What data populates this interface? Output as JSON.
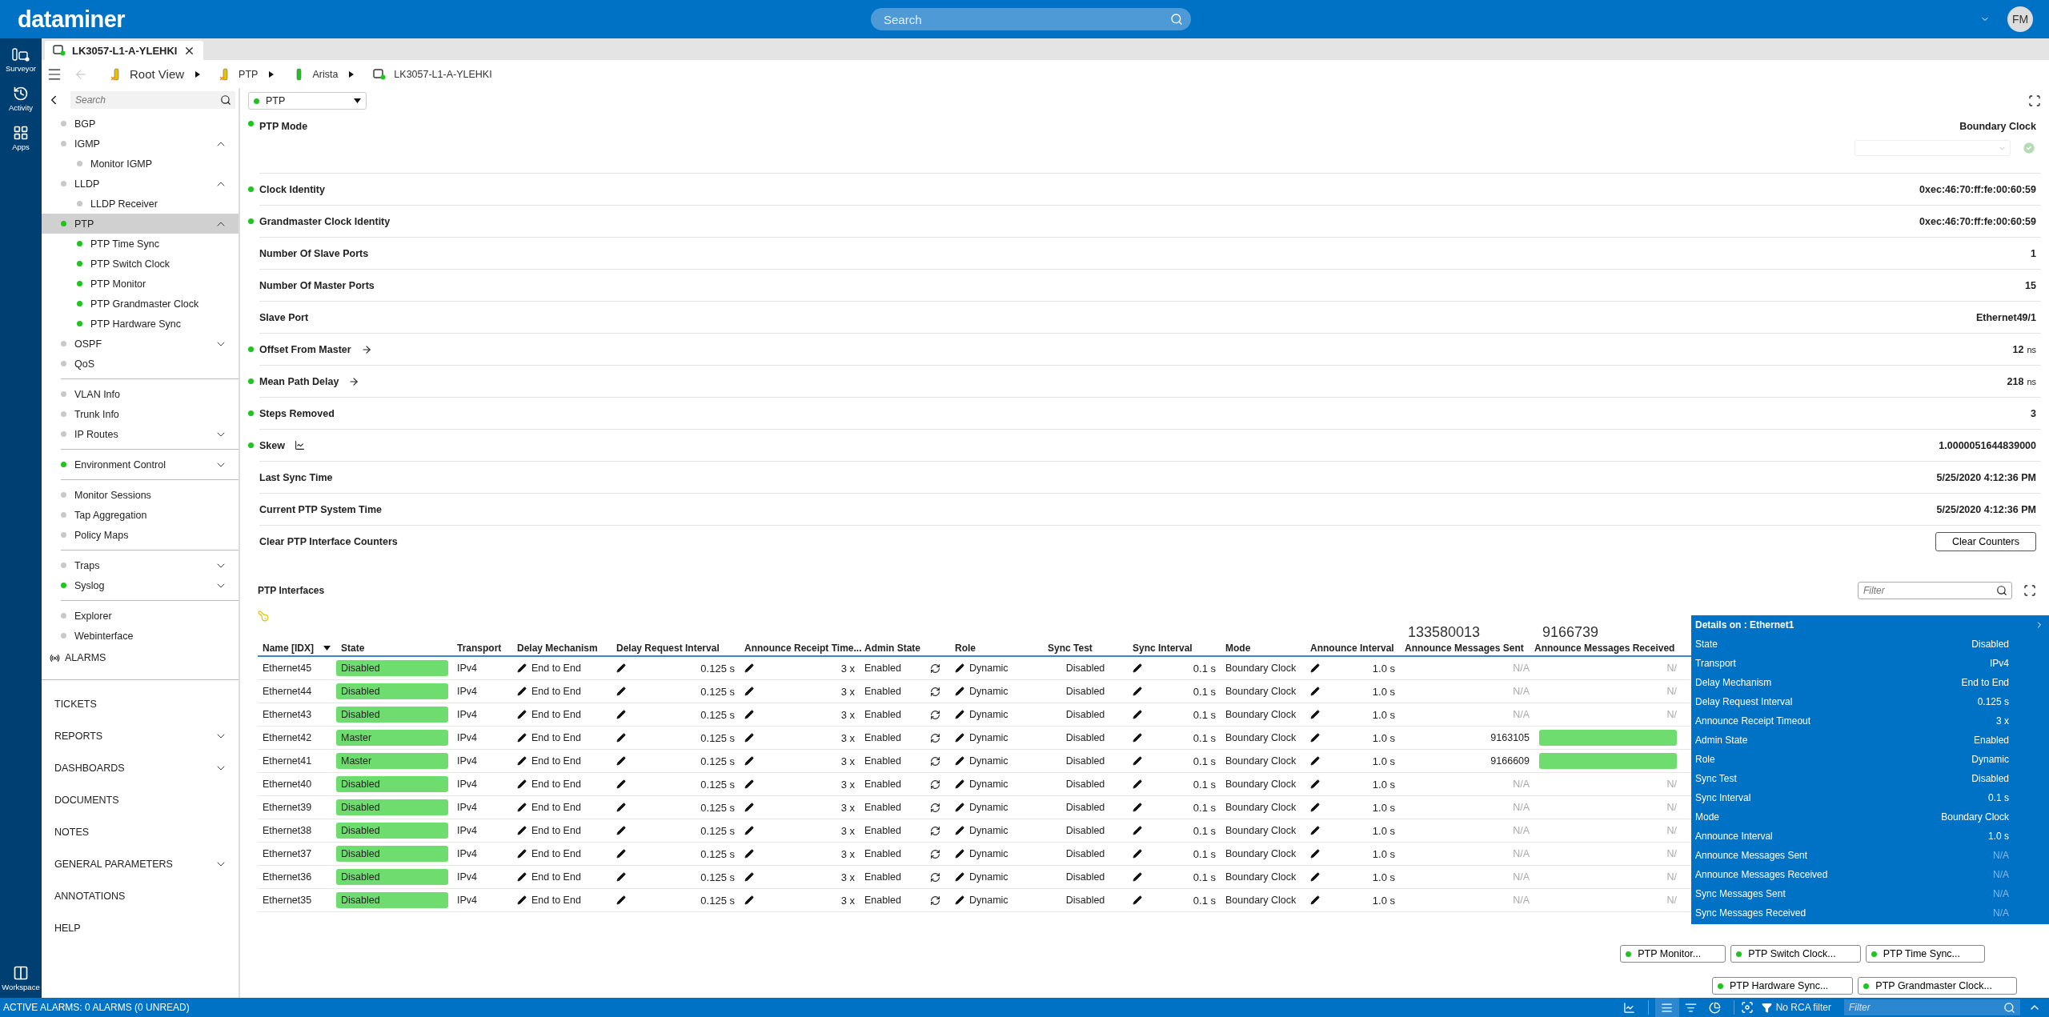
{
  "header": {
    "logo": "dataminer",
    "search_placeholder": "Search",
    "avatar": "FM"
  },
  "rail": {
    "items": [
      {
        "label": "Surveyor",
        "kind": "surveyor"
      },
      {
        "label": "Activity",
        "kind": "activity"
      },
      {
        "label": "Apps",
        "kind": "apps"
      }
    ],
    "bottom": "Workspace"
  },
  "tabs": [
    {
      "label": "LK3057-L1-A-YLEHKI",
      "selected": true
    }
  ],
  "breadcrumb": [
    {
      "label": "Root View",
      "kind": "view"
    },
    {
      "label": "PTP",
      "kind": "view"
    },
    {
      "label": "Arista",
      "kind": "protocol"
    },
    {
      "label": "LK3057-L1-A-YLEHKI",
      "kind": "element"
    }
  ],
  "sidebar": {
    "search_placeholder": "Search",
    "groups": [
      [
        {
          "label": "BGP",
          "color": "#c8c8c8",
          "selected": false
        },
        {
          "label": "IGMP",
          "color": "#c8c8c8",
          "selected": false,
          "expanded": true,
          "children": [
            {
              "label": "Monitor IGMP",
              "color": "#c8c8c8",
              "selected": false
            }
          ]
        },
        {
          "label": "LLDP",
          "color": "#c8c8c8",
          "selected": false,
          "expanded": true,
          "children": [
            {
              "label": "LLDP Receiver",
              "color": "#c8c8c8",
              "selected": false
            }
          ]
        },
        {
          "label": "PTP",
          "color": "#1fc41f",
          "selected": true,
          "expanded": true,
          "children": [
            {
              "label": "PTP Time Sync",
              "color": "#1fc41f",
              "selected": false
            },
            {
              "label": "PTP Switch Clock",
              "color": "#1fc41f",
              "selected": false
            },
            {
              "label": "PTP Monitor",
              "color": "#1fc41f",
              "selected": false
            },
            {
              "label": "PTP Grandmaster Clock",
              "color": "#1fc41f",
              "selected": false
            },
            {
              "label": "PTP Hardware Sync",
              "color": "#1fc41f",
              "selected": false
            }
          ]
        },
        {
          "label": "OSPF",
          "color": "#c8c8c8",
          "selected": false,
          "expanded": false
        },
        {
          "label": "QoS",
          "color": "#c8c8c8",
          "selected": false
        }
      ],
      [
        {
          "label": "VLAN Info",
          "color": "#c8c8c8",
          "selected": false
        },
        {
          "label": "Trunk Info",
          "color": "#c8c8c8",
          "selected": false
        },
        {
          "label": "IP Routes",
          "color": "#c8c8c8",
          "selected": false,
          "expanded": false
        }
      ],
      [
        {
          "label": "Environment Control",
          "color": "#1fc41f",
          "selected": false,
          "expanded": false
        }
      ],
      [
        {
          "label": "Monitor Sessions",
          "color": "#c8c8c8",
          "selected": false
        },
        {
          "label": "Tap Aggregation",
          "color": "#c8c8c8",
          "selected": false
        },
        {
          "label": "Policy Maps",
          "color": "#c8c8c8",
          "selected": false
        }
      ],
      [
        {
          "label": "Traps",
          "color": "#c8c8c8",
          "selected": false,
          "expanded": false
        },
        {
          "label": "Syslog",
          "color": "#1fc41f",
          "selected": false,
          "expanded": false
        }
      ],
      [
        {
          "label": "Explorer",
          "color": "#c8c8c8",
          "selected": false
        },
        {
          "label": "Webinterface",
          "color": "#c8c8c8",
          "selected": false
        }
      ]
    ],
    "alarms": "ALARMS",
    "menu": [
      {
        "label": "TICKETS"
      },
      {
        "label": "REPORTS",
        "expanded": false
      },
      {
        "label": "DASHBOARDS",
        "expanded": false
      },
      {
        "label": "DOCUMENTS"
      },
      {
        "label": "NOTES"
      },
      {
        "label": "GENERAL PARAMETERS",
        "expanded": false
      },
      {
        "label": "ANNOTATIONS"
      },
      {
        "label": "HELP"
      }
    ]
  },
  "page_select": "PTP",
  "parameters": [
    {
      "label": "PTP Mode",
      "dot": true,
      "kind": "select",
      "value": "Boundary Clock"
    },
    {
      "label": "Clock Identity",
      "dot": true,
      "kind": "plain",
      "value": "0xec:46:70:ff:fe:00:60:59"
    },
    {
      "label": "Grandmaster Clock Identity",
      "dot": true,
      "kind": "plain",
      "value": "0xec:46:70:ff:fe:00:60:59"
    },
    {
      "label": "Number Of Slave Ports",
      "dot": false,
      "kind": "plain",
      "value": "1"
    },
    {
      "label": "Number Of Master Ports",
      "dot": false,
      "kind": "plain",
      "value": "15"
    },
    {
      "label": "Slave Port",
      "dot": false,
      "kind": "plain",
      "value": "Ethernet49/1"
    },
    {
      "label": "Offset From Master",
      "dot": true,
      "kind": "plain",
      "link": {
        "kind": "arrow"
      },
      "value": "12",
      "unit": "ns"
    },
    {
      "label": "Mean Path Delay",
      "dot": true,
      "kind": "plain",
      "link": {
        "kind": "arrow"
      },
      "value": "218",
      "unit": "ns"
    },
    {
      "label": "Steps Removed",
      "dot": true,
      "kind": "plain",
      "value": "3"
    },
    {
      "label": "Skew",
      "dot": true,
      "kind": "plain",
      "link": {
        "kind": "trend"
      },
      "value": "1.0000051644839000"
    },
    {
      "label": "Last Sync Time",
      "dot": false,
      "kind": "plain",
      "value": "5/25/2020 4:12:36 PM"
    },
    {
      "label": "Current PTP System Time",
      "dot": false,
      "kind": "plain",
      "value": "5/25/2020 4:12:36 PM"
    },
    {
      "label": "Clear PTP Interface Counters",
      "dot": false,
      "kind": "button",
      "value": "Clear Counters"
    }
  ],
  "interfaces": {
    "title": "PTP Interfaces",
    "filter_placeholder": "Filter",
    "columns": [
      {
        "label": "Name [IDX]",
        "sorted": true
      },
      {
        "label": "State",
        "sorted": false
      },
      {
        "label": "Transport",
        "sorted": false
      },
      {
        "label": "Delay Mechanism",
        "sorted": false
      },
      {
        "label": "Delay Request Interval",
        "sorted": false
      },
      {
        "label": "Announce Receipt Time...",
        "sorted": false
      },
      {
        "label": "Admin State",
        "sorted": false
      },
      {
        "label": "Role",
        "sorted": false
      },
      {
        "label": "Sync Test",
        "sorted": false
      },
      {
        "label": "Sync Interval",
        "sorted": false
      },
      {
        "label": "Mode",
        "sorted": false
      },
      {
        "label": "Announce Interval",
        "sorted": false
      },
      {
        "label": "Announce Messages Sent",
        "sorted": false
      },
      {
        "label": "Announce Messages Received",
        "sorted": false
      }
    ],
    "column_totals": {
      "messages_sent": "133580013",
      "messages_received": "9166739"
    },
    "rows": [
      {
        "name": "Ethernet45",
        "state": "Disabled",
        "transport": "IPv4",
        "delay_mechanism": "End to End",
        "delay_request_interval": "0.125 s",
        "announce_receipt_timeout": "3 x",
        "admin_state": "Enabled",
        "role": "Dynamic",
        "sync_test": "Disabled",
        "sync_interval": "0.1 s",
        "mode": "Boundary Clock",
        "announce_interval": "1.0 s",
        "messages_sent": "N/A",
        "sent_muted": true,
        "received_bar": false,
        "messages_received": "N/"
      },
      {
        "name": "Ethernet44",
        "state": "Disabled",
        "transport": "IPv4",
        "delay_mechanism": "End to End",
        "delay_request_interval": "0.125 s",
        "announce_receipt_timeout": "3 x",
        "admin_state": "Enabled",
        "role": "Dynamic",
        "sync_test": "Disabled",
        "sync_interval": "0.1 s",
        "mode": "Boundary Clock",
        "announce_interval": "1.0 s",
        "messages_sent": "N/A",
        "sent_muted": true,
        "received_bar": false,
        "messages_received": "N/"
      },
      {
        "name": "Ethernet43",
        "state": "Disabled",
        "transport": "IPv4",
        "delay_mechanism": "End to End",
        "delay_request_interval": "0.125 s",
        "announce_receipt_timeout": "3 x",
        "admin_state": "Enabled",
        "role": "Dynamic",
        "sync_test": "Disabled",
        "sync_interval": "0.1 s",
        "mode": "Boundary Clock",
        "announce_interval": "1.0 s",
        "messages_sent": "N/A",
        "sent_muted": true,
        "received_bar": false,
        "messages_received": "N/"
      },
      {
        "name": "Ethernet42",
        "state": "Master",
        "transport": "IPv4",
        "delay_mechanism": "End to End",
        "delay_request_interval": "0.125 s",
        "announce_receipt_timeout": "3 x",
        "admin_state": "Enabled",
        "role": "Dynamic",
        "sync_test": "Disabled",
        "sync_interval": "0.1 s",
        "mode": "Boundary Clock",
        "announce_interval": "1.0 s",
        "messages_sent": "9163105",
        "sent_muted": false,
        "received_bar": true
      },
      {
        "name": "Ethernet41",
        "state": "Master",
        "transport": "IPv4",
        "delay_mechanism": "End to End",
        "delay_request_interval": "0.125 s",
        "announce_receipt_timeout": "3 x",
        "admin_state": "Enabled",
        "role": "Dynamic",
        "sync_test": "Disabled",
        "sync_interval": "0.1 s",
        "mode": "Boundary Clock",
        "announce_interval": "1.0 s",
        "messages_sent": "9166609",
        "sent_muted": false,
        "received_bar": true
      },
      {
        "name": "Ethernet40",
        "state": "Disabled",
        "transport": "IPv4",
        "delay_mechanism": "End to End",
        "delay_request_interval": "0.125 s",
        "announce_receipt_timeout": "3 x",
        "admin_state": "Enabled",
        "role": "Dynamic",
        "sync_test": "Disabled",
        "sync_interval": "0.1 s",
        "mode": "Boundary Clock",
        "announce_interval": "1.0 s",
        "messages_sent": "N/A",
        "sent_muted": true,
        "received_bar": false,
        "messages_received": "N/"
      },
      {
        "name": "Ethernet39",
        "state": "Disabled",
        "transport": "IPv4",
        "delay_mechanism": "End to End",
        "delay_request_interval": "0.125 s",
        "announce_receipt_timeout": "3 x",
        "admin_state": "Enabled",
        "role": "Dynamic",
        "sync_test": "Disabled",
        "sync_interval": "0.1 s",
        "mode": "Boundary Clock",
        "announce_interval": "1.0 s",
        "messages_sent": "N/A",
        "sent_muted": true,
        "received_bar": false,
        "messages_received": "N/"
      },
      {
        "name": "Ethernet38",
        "state": "Disabled",
        "transport": "IPv4",
        "delay_mechanism": "End to End",
        "delay_request_interval": "0.125 s",
        "announce_receipt_timeout": "3 x",
        "admin_state": "Enabled",
        "role": "Dynamic",
        "sync_test": "Disabled",
        "sync_interval": "0.1 s",
        "mode": "Boundary Clock",
        "announce_interval": "1.0 s",
        "messages_sent": "N/A",
        "sent_muted": true,
        "received_bar": false,
        "messages_received": "N/"
      },
      {
        "name": "Ethernet37",
        "state": "Disabled",
        "transport": "IPv4",
        "delay_mechanism": "End to End",
        "delay_request_interval": "0.125 s",
        "announce_receipt_timeout": "3 x",
        "admin_state": "Enabled",
        "role": "Dynamic",
        "sync_test": "Disabled",
        "sync_interval": "0.1 s",
        "mode": "Boundary Clock",
        "announce_interval": "1.0 s",
        "messages_sent": "N/A",
        "sent_muted": true,
        "received_bar": false,
        "messages_received": "N/"
      },
      {
        "name": "Ethernet36",
        "state": "Disabled",
        "transport": "IPv4",
        "delay_mechanism": "End to End",
        "delay_request_interval": "0.125 s",
        "announce_receipt_timeout": "3 x",
        "admin_state": "Enabled",
        "role": "Dynamic",
        "sync_test": "Disabled",
        "sync_interval": "0.1 s",
        "mode": "Boundary Clock",
        "announce_interval": "1.0 s",
        "messages_sent": "N/A",
        "sent_muted": true,
        "received_bar": false,
        "messages_received": "N/"
      },
      {
        "name": "Ethernet35",
        "state": "Disabled",
        "transport": "IPv4",
        "delay_mechanism": "End to End",
        "delay_request_interval": "0.125 s",
        "announce_receipt_timeout": "3 x",
        "admin_state": "Enabled",
        "role": "Dynamic",
        "sync_test": "Disabled",
        "sync_interval": "0.1 s",
        "mode": "Boundary Clock",
        "announce_interval": "1.0 s",
        "messages_sent": "N/A",
        "sent_muted": true,
        "received_bar": false,
        "messages_received": "N/"
      }
    ],
    "details": {
      "title": "Details on : Ethernet1",
      "rows": [
        {
          "label": "State",
          "value": "Disabled",
          "muted": false
        },
        {
          "label": "Transport",
          "value": "IPv4",
          "muted": false
        },
        {
          "label": "Delay Mechanism",
          "value": "End to End",
          "muted": false
        },
        {
          "label": "Delay Request Interval",
          "value": "0.125 s",
          "muted": false
        },
        {
          "label": "Announce Receipt Timeout",
          "value": "3 x",
          "muted": false
        },
        {
          "label": "Admin State",
          "value": "Enabled",
          "muted": false
        },
        {
          "label": "Role",
          "value": "Dynamic",
          "muted": false
        },
        {
          "label": "Sync Test",
          "value": "Disabled",
          "muted": false
        },
        {
          "label": "Sync Interval",
          "value": "0.1 s",
          "muted": false
        },
        {
          "label": "Mode",
          "value": "Boundary Clock",
          "muted": false
        },
        {
          "label": "Announce Interval",
          "value": "1.0 s",
          "muted": false
        },
        {
          "label": "Announce Messages Sent",
          "value": "N/A",
          "muted": true
        },
        {
          "label": "Announce Messages Received",
          "value": "N/A",
          "muted": true
        },
        {
          "label": "Sync Messages Sent",
          "value": "N/A",
          "muted": true
        },
        {
          "label": "Sync Messages Received",
          "value": "N/A",
          "muted": true
        }
      ]
    }
  },
  "linked_pages": [
    [
      {
        "label": "PTP Monitor...",
        "color": "#1fc41f"
      },
      {
        "label": "PTP Switch Clock...",
        "color": "#1fc41f"
      },
      {
        "label": "PTP Time Sync...",
        "color": "#1fc41f"
      }
    ],
    [
      {
        "label": "PTP Hardware Sync...",
        "color": "#1fc41f"
      },
      {
        "label": "PTP Grandmaster Clock...",
        "color": "#1fc41f"
      }
    ]
  ],
  "status_bar": {
    "alarms": "ACTIVE ALARMS: 0 ALARMS (0 UNREAD)",
    "views": [
      {
        "kind": "trend",
        "selected": false
      },
      {
        "kind": "list",
        "selected": true
      },
      {
        "kind": "sort",
        "selected": false
      },
      {
        "kind": "pie",
        "selected": false
      }
    ],
    "rca_filter": "No RCA filter",
    "filter_placeholder": "Filter"
  }
}
